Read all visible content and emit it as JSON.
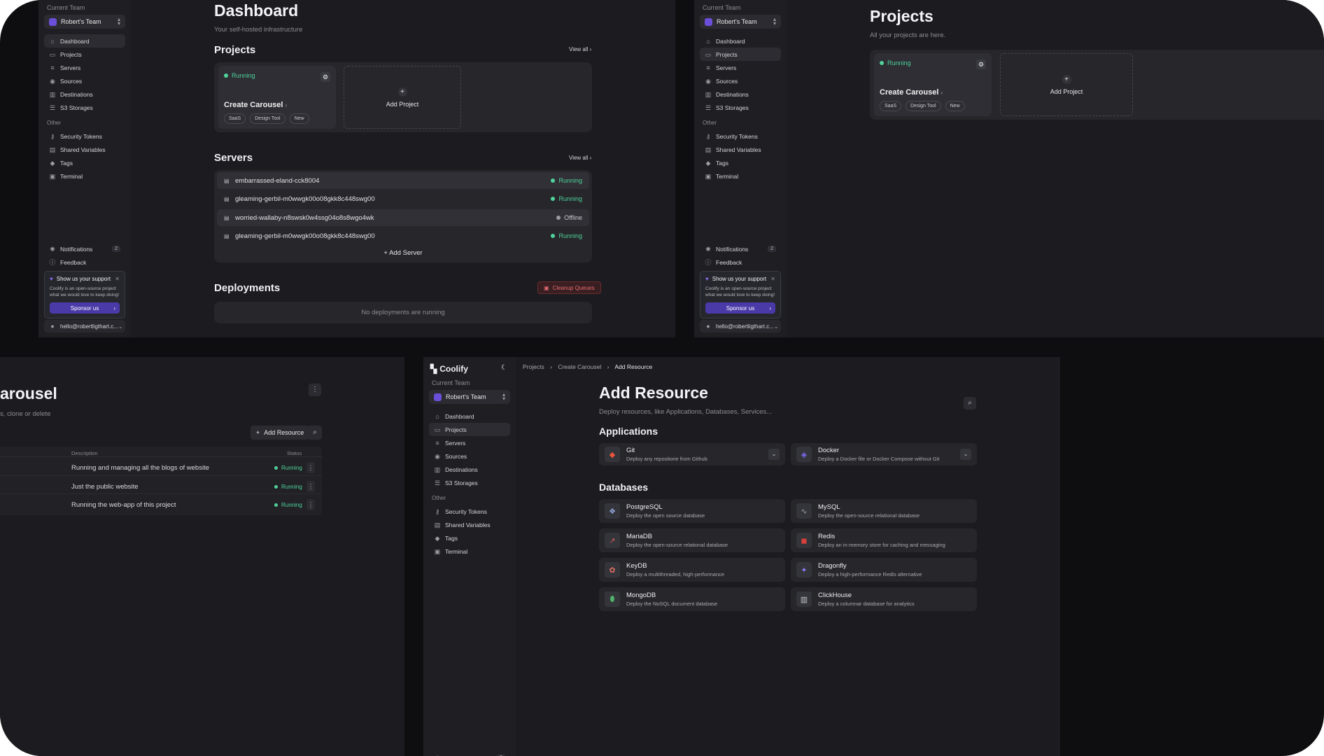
{
  "colors": {
    "bg": "#0e0e11",
    "panel": "#1c1c20",
    "sidebar": "#1f1f23",
    "running": "#4fd39a",
    "accent": "#4a3aa8",
    "danger": "#e26a70"
  },
  "sidebar": {
    "team_label": "Current Team",
    "team_name": "Robert's Team",
    "nav": {
      "dashboard": "Dashboard",
      "projects": "Projects",
      "servers": "Servers",
      "sources": "Sources",
      "destinations": "Destinations",
      "s3": "S3 Storages"
    },
    "other_label": "Other",
    "other": {
      "tokens": "Security Tokens",
      "variables": "Shared Variables",
      "tags": "Tags",
      "terminal": "Terminal"
    },
    "notifications": "Notifications",
    "notifications_count": "2",
    "feedback": "Feedback",
    "support": {
      "title": "Show us your support",
      "text": "Coolify is an open-source project what we would love to keep doing!",
      "button": "Sponsor us"
    },
    "user_email": "hello@robertligthart.c..."
  },
  "dashboard": {
    "title": "Dashboard",
    "subtitle": "Your self-hosted infrastructure",
    "projects_heading": "Projects",
    "view_all": "View all",
    "project": {
      "status": "Running",
      "name": "Create Carousel",
      "tags": [
        "SaaS",
        "Design Tool",
        "New"
      ]
    },
    "add_project": "Add Project",
    "servers_heading": "Servers",
    "servers": [
      {
        "name": "embarrassed-eland-cck8004",
        "status": "Running"
      },
      {
        "name": "gleaming-gerbil-m0wwgk00o08gkk8c448swg00",
        "status": "Running"
      },
      {
        "name": "worried-wallaby-n8swsk0w4ssg04o8s8wgo4wk",
        "status": "Offline"
      },
      {
        "name": "gleaming-gerbil-m0wwgk00o08gkk8c448swg00",
        "status": "Running"
      }
    ],
    "add_server": "Add Server",
    "deployments_heading": "Deployments",
    "cleanup": "Cleanup Queues",
    "no_deployments": "No deployments are running"
  },
  "projects_page": {
    "title": "Projects",
    "subtitle": "All your projects are here.",
    "project": {
      "status": "Running",
      "name": "Create Carousel",
      "tags": [
        "SaaS",
        "Design Tool",
        "New"
      ]
    },
    "add_project": "Add Project"
  },
  "project_detail": {
    "title": "arousel",
    "subtitle": "s, clone or delete",
    "add_resource": "Add Resource",
    "columns": {
      "description": "Description",
      "status": "Status"
    },
    "rows": [
      {
        "description": "Running and managing all the blogs of website",
        "status": "Running"
      },
      {
        "description": "Just the public website",
        "status": "Running"
      },
      {
        "description": "Running the web-app of this project",
        "status": "Running"
      }
    ]
  },
  "add_resource_page": {
    "logo": "Coolify",
    "breadcrumb": [
      "Projects",
      "Create Carousel",
      "Add Resource"
    ],
    "title": "Add Resource",
    "subtitle": "Deploy resources, like Applications, Databases, Services...",
    "applications_heading": "Applications",
    "applications": [
      {
        "name": "Git",
        "desc": "Deploy any repositorie from Github",
        "icon": "git-icon",
        "color": "#e8553c"
      },
      {
        "name": "Docker",
        "desc": "Deploy a Docker file or Docker Compose without Git",
        "icon": "docker-icon",
        "color": "#7d6cf2"
      }
    ],
    "databases_heading": "Databases",
    "databases": [
      {
        "name": "PostgreSQL",
        "desc": "Deploy the open source database",
        "icon": "postgresql-icon",
        "color": "#8fa6d9"
      },
      {
        "name": "MySQL",
        "desc": "Deploy the open-source relational database",
        "icon": "mysql-icon",
        "color": "#9aa0a8"
      },
      {
        "name": "MariaDB",
        "desc": "Deploy the open-source relational database",
        "icon": "mariadb-icon",
        "color": "#d0605b"
      },
      {
        "name": "Redis",
        "desc": "Deploy an in-memory store for caching and messaging",
        "icon": "redis-icon",
        "color": "#d8413a"
      },
      {
        "name": "KeyDB",
        "desc": "Deploy a multithreaded, high-performance",
        "icon": "keydb-icon",
        "color": "#e07060"
      },
      {
        "name": "Dragonfly",
        "desc": "Deploy a high-performance Redis alternative",
        "icon": "dragonfly-icon",
        "color": "#8b7cf5"
      },
      {
        "name": "MongoDB",
        "desc": "Deploy the NoSQL document database",
        "icon": "mongodb-icon",
        "color": "#4fb36b"
      },
      {
        "name": "ClickHouse",
        "desc": "Deploy a columnar database for analytics",
        "icon": "clickhouse-icon",
        "color": "#c9c9cf"
      }
    ]
  }
}
